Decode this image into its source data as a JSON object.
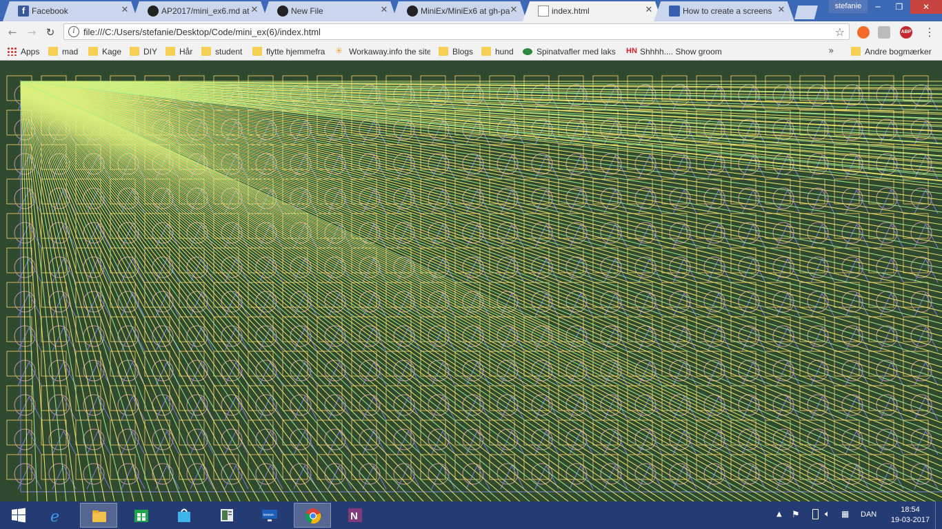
{
  "browser": {
    "tabs": [
      {
        "title": "Facebook",
        "icon": "facebook-icon",
        "active": false
      },
      {
        "title": "AP2017/mini_ex6.md at",
        "icon": "github-icon",
        "active": false
      },
      {
        "title": "New File",
        "icon": "github-icon",
        "active": false
      },
      {
        "title": "MiniEx/MiniEx6 at gh-pa",
        "icon": "github-icon",
        "active": false
      },
      {
        "title": "index.html",
        "icon": "document-icon",
        "active": true
      },
      {
        "title": "How to create a screens",
        "icon": "page-icon",
        "active": false
      }
    ],
    "profile": "stefanie",
    "address": "file:///C:/Users/stefanie/Desktop/Code/mini_ex(6)/index.html",
    "bookmarks": [
      {
        "label": "Apps",
        "icon": "apps-grid-icon"
      },
      {
        "label": "mad",
        "icon": "folder-icon"
      },
      {
        "label": "Kage",
        "icon": "folder-icon"
      },
      {
        "label": "DIY",
        "icon": "folder-icon"
      },
      {
        "label": "Hår",
        "icon": "folder-icon"
      },
      {
        "label": "student",
        "icon": "folder-icon"
      },
      {
        "label": "flytte hjemmefra",
        "icon": "folder-icon"
      },
      {
        "label": "Workaway.info the site",
        "icon": "workaway-icon"
      },
      {
        "label": "Blogs",
        "icon": "folder-icon"
      },
      {
        "label": "hund",
        "icon": "folder-icon"
      },
      {
        "label": "Spinatvafler med laks",
        "icon": "recipe-icon"
      },
      {
        "label": "Shhhh.... Show groom",
        "icon": "hn-icon"
      }
    ],
    "other_bookmarks": "Andre bogmærker",
    "extensions": {
      "adblock_label": "ABP"
    }
  },
  "artwork": {
    "background": "#2f4a2e",
    "colors": {
      "square": "#d8b55e",
      "circle": "#c79aa0",
      "triangle": "#7f7fd8",
      "line_yellow": "#f3ee73",
      "line_green": "#a8ef8d"
    },
    "grid_cols": 27,
    "grid_rows": 12
  },
  "taskbar": {
    "apps": [
      "start-icon",
      "internet-explorer-icon",
      "file-explorer-icon",
      "store-icon",
      "shopping-bag-icon",
      "reader-icon",
      "lenovo-icon",
      "chrome-icon",
      "onenote-icon"
    ],
    "language": "DAN",
    "time": "18:54",
    "date": "19-03-2017"
  }
}
